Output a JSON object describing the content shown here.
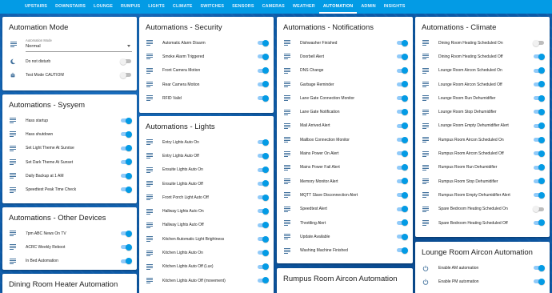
{
  "tabs": [
    "UPSTAIRS",
    "DOWNSTAIRS",
    "LOUNGE",
    "RUMPUS",
    "LIGHTS",
    "CLIMATE",
    "SWITCHES",
    "SENSORS",
    "CAMERAS",
    "WEATHER",
    "AUTOMATION",
    "ADMIN",
    "INSIGHTS"
  ],
  "active_tab": "AUTOMATION",
  "mode": {
    "title": "Automation Mode",
    "select_label": "Automation Mode",
    "select_value": "Normal",
    "items": [
      {
        "label": "Do not disturb",
        "on": false,
        "icon": "moon-icon"
      },
      {
        "label": "Test Mode CAUTION!",
        "on": false,
        "icon": "robot-icon"
      }
    ]
  },
  "system": {
    "title": "Automations - Sysyem",
    "items": [
      {
        "label": "Hass startup",
        "on": true
      },
      {
        "label": "Hass shutdown",
        "on": true
      },
      {
        "label": "Set Light Theme At Sunrise",
        "on": true
      },
      {
        "label": "Set Dark Theme At Sunset",
        "on": true
      },
      {
        "label": "Daily Backup at 1 AM",
        "on": true
      },
      {
        "label": "Speedtest Peak Time Check",
        "on": true
      }
    ]
  },
  "other": {
    "title": "Automations - Other Devices",
    "items": [
      {
        "label": "7pm ABC News On TV",
        "on": true
      },
      {
        "label": "ACRC Weekly Reboot",
        "on": true
      },
      {
        "label": "In Bed Automation",
        "on": true
      }
    ]
  },
  "dining": {
    "title": "Dining Room Heater Automation"
  },
  "security": {
    "title": "Automations - Security",
    "items": [
      {
        "label": "Automatic Alarm Disarm",
        "on": true
      },
      {
        "label": "Smoke Alarm Triggered",
        "on": true
      },
      {
        "label": "Front Camera Motion",
        "on": true
      },
      {
        "label": "Rear Camera Motion",
        "on": true
      },
      {
        "label": "RFID Valid",
        "on": true
      }
    ]
  },
  "lights": {
    "title": "Automations - Lights",
    "items": [
      {
        "label": "Entry Lights Auto On",
        "on": true
      },
      {
        "label": "Entry Lights Auto Off",
        "on": true
      },
      {
        "label": "Ensuite Lights Auto On",
        "on": true
      },
      {
        "label": "Ensuite Lights Auto Off",
        "on": true
      },
      {
        "label": "Front Porch Light Auto Off",
        "on": true
      },
      {
        "label": "Hallway Lights Auto On",
        "on": true
      },
      {
        "label": "Hallway Lights Auto Off",
        "on": true
      },
      {
        "label": "Kitchen Automatic Light Brightness",
        "on": true
      },
      {
        "label": "Kitchen Lights Auto On",
        "on": true
      },
      {
        "label": "Kitchen Lights Auto Off (Lux)",
        "on": true
      },
      {
        "label": "Kitchen Lights Auto Off (movement)",
        "on": true
      }
    ]
  },
  "notifications": {
    "title": "Automations - Notifications",
    "items": [
      {
        "label": "Dishwasher Finished",
        "on": true
      },
      {
        "label": "Doorbell Alert",
        "on": true
      },
      {
        "label": "DNS Change",
        "on": true
      },
      {
        "label": "Garbage Reminder",
        "on": true
      },
      {
        "label": "Lane Gate Connection Monitor",
        "on": true
      },
      {
        "label": "Lane Gate Notification",
        "on": true
      },
      {
        "label": "Mail Arrived Alert",
        "on": true
      },
      {
        "label": "Mailbox Connection Monitor",
        "on": true
      },
      {
        "label": "Mains Power On Alert",
        "on": true
      },
      {
        "label": "Mains Power Fail Alert",
        "on": true
      },
      {
        "label": "Memory Monitor Alert",
        "on": true
      },
      {
        "label": "MQTT Slave Disconnection Alert",
        "on": true
      },
      {
        "label": "Speedtest Alert",
        "on": true
      },
      {
        "label": "Throttling Alert",
        "on": true
      },
      {
        "label": "Update Available",
        "on": true
      },
      {
        "label": "Washing Machine Finished",
        "on": true
      }
    ]
  },
  "rumpus": {
    "title": "Rumpus Room Aircon Automation"
  },
  "climate": {
    "title": "Automations - Climate",
    "items": [
      {
        "label": "Dining Room Heating Scheduled On",
        "on": false
      },
      {
        "label": "Dining Room Heating Scheduled Off",
        "on": true
      },
      {
        "label": "Lounge Room Aircon Scheduled On",
        "on": true
      },
      {
        "label": "Lounge Room Aircon Scheduled Off",
        "on": true
      },
      {
        "label": "Lounge Room Run Dehumidifier",
        "on": true
      },
      {
        "label": "Lounge Room Stop Dehumidifier",
        "on": true
      },
      {
        "label": "Lounge Room Empty Dehumidifier Alert",
        "on": true
      },
      {
        "label": "Rumpus Room Aircon Scheduled On",
        "on": true
      },
      {
        "label": "Rumpus Room Aircon Scheduled Off",
        "on": true
      },
      {
        "label": "Rumpus Room Run Dehumidifier",
        "on": true
      },
      {
        "label": "Rumpus Room Stop Dehumidifier",
        "on": true
      },
      {
        "label": "Rumpus Room Empty Dehumidifier Alert",
        "on": true
      },
      {
        "label": "Spare Bedroom Heating Scheduled On",
        "on": false
      },
      {
        "label": "Spare Bedroom Heating Scheduled Off",
        "on": true
      }
    ]
  },
  "lounge_aircon": {
    "title": "Lounge Room Aircon Automation",
    "items": [
      {
        "label": "Enable AM automation",
        "on": true
      },
      {
        "label": "Enable PM automation",
        "on": true
      }
    ]
  }
}
